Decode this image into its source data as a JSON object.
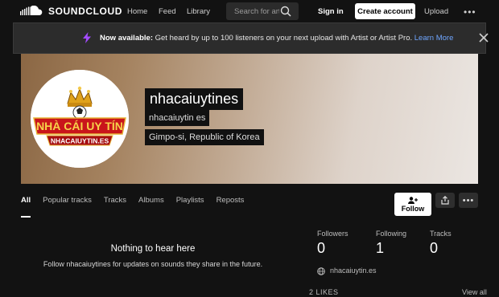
{
  "nav": {
    "brand": "SOUNDCLOUD",
    "home": "Home",
    "feed": "Feed",
    "library": "Library",
    "search_placeholder": "Search for art",
    "signin": "Sign in",
    "create_account": "Create account",
    "upload": "Upload"
  },
  "notice": {
    "bold": "Now available:",
    "text": " Get heard by up to 100 listeners on your next upload with Artist or Artist Pro. ",
    "link": "Learn More"
  },
  "profile": {
    "username": "nhacaiuytines",
    "realname": "nhacaiuytin es",
    "location": "Gimpo-si, Republic of Korea",
    "avatar_text_main": "NHÀ CÁI UY TÍN",
    "avatar_text_sub": "NHACAIUYTIN.ES",
    "website": "nhacaiuytin.es"
  },
  "tabs": [
    {
      "label": "All"
    },
    {
      "label": "Popular tracks"
    },
    {
      "label": "Tracks"
    },
    {
      "label": "Albums"
    },
    {
      "label": "Playlists"
    },
    {
      "label": "Reposts"
    }
  ],
  "actions": {
    "follow": "Follow"
  },
  "empty": {
    "title": "Nothing to hear here",
    "subtitle": "Follow nhacaiuytines for updates on sounds they share in the future."
  },
  "stats": {
    "followers_label": "Followers",
    "followers": "0",
    "following_label": "Following",
    "following": "1",
    "tracks_label": "Tracks",
    "tracks": "0"
  },
  "likes": {
    "label": "2 LIKES",
    "view_all": "View all"
  },
  "colors": {
    "background": "#121212",
    "link": "#6fa6ff",
    "accent_purple": "#a34bff"
  }
}
